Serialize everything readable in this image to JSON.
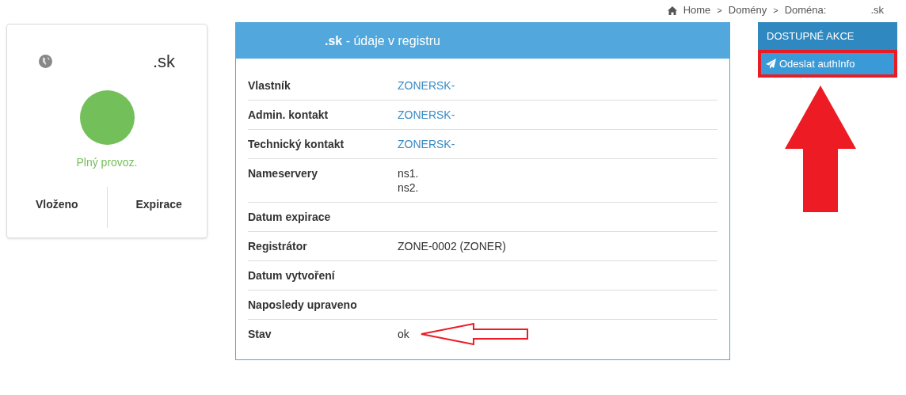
{
  "breadcrumb": [
    {
      "label": "Home",
      "kind": "home"
    },
    {
      "separator": ">",
      "label": "Domény",
      "kind": "link"
    },
    {
      "separator": ">",
      "label": "Doména:",
      "kind": "link"
    },
    {
      "label": ".sk",
      "kind": "text"
    }
  ],
  "domain_card": {
    "domain": ".sk",
    "status": "Plný provoz.",
    "stats": [
      {
        "label": "Vloženo"
      },
      {
        "label": "Expirace"
      }
    ]
  },
  "registry_panel": {
    "title": "**.sk** - údaje v registru",
    "rows": [
      {
        "label": "Vlastník",
        "kind": "link",
        "values": [
          "ZONERSK-"
        ]
      },
      {
        "label": "Admin. kontakt",
        "kind": "link",
        "values": [
          "ZONERSK-"
        ]
      },
      {
        "label": "Technický kontakt",
        "kind": "link",
        "values": [
          "ZONERSK-"
        ]
      },
      {
        "label": "Nameservery",
        "kind": "text",
        "values": [
          "ns1.",
          "ns2."
        ]
      },
      {
        "label": "Datum expirace"
      },
      {
        "label": "Registrátor",
        "kind": "text",
        "values": [
          "ZONE-0002 (ZONER)"
        ]
      },
      {
        "label": "Datum vytvoření"
      },
      {
        "label": "Naposledy upraveno"
      },
      {
        "label": "Stav",
        "kind": "text",
        "values": [
          "ok"
        ]
      }
    ]
  },
  "actions": {
    "title": "DOSTUPNÉ AKCE",
    "items": [
      {
        "label": "Odeslat authInfo"
      }
    ]
  }
}
